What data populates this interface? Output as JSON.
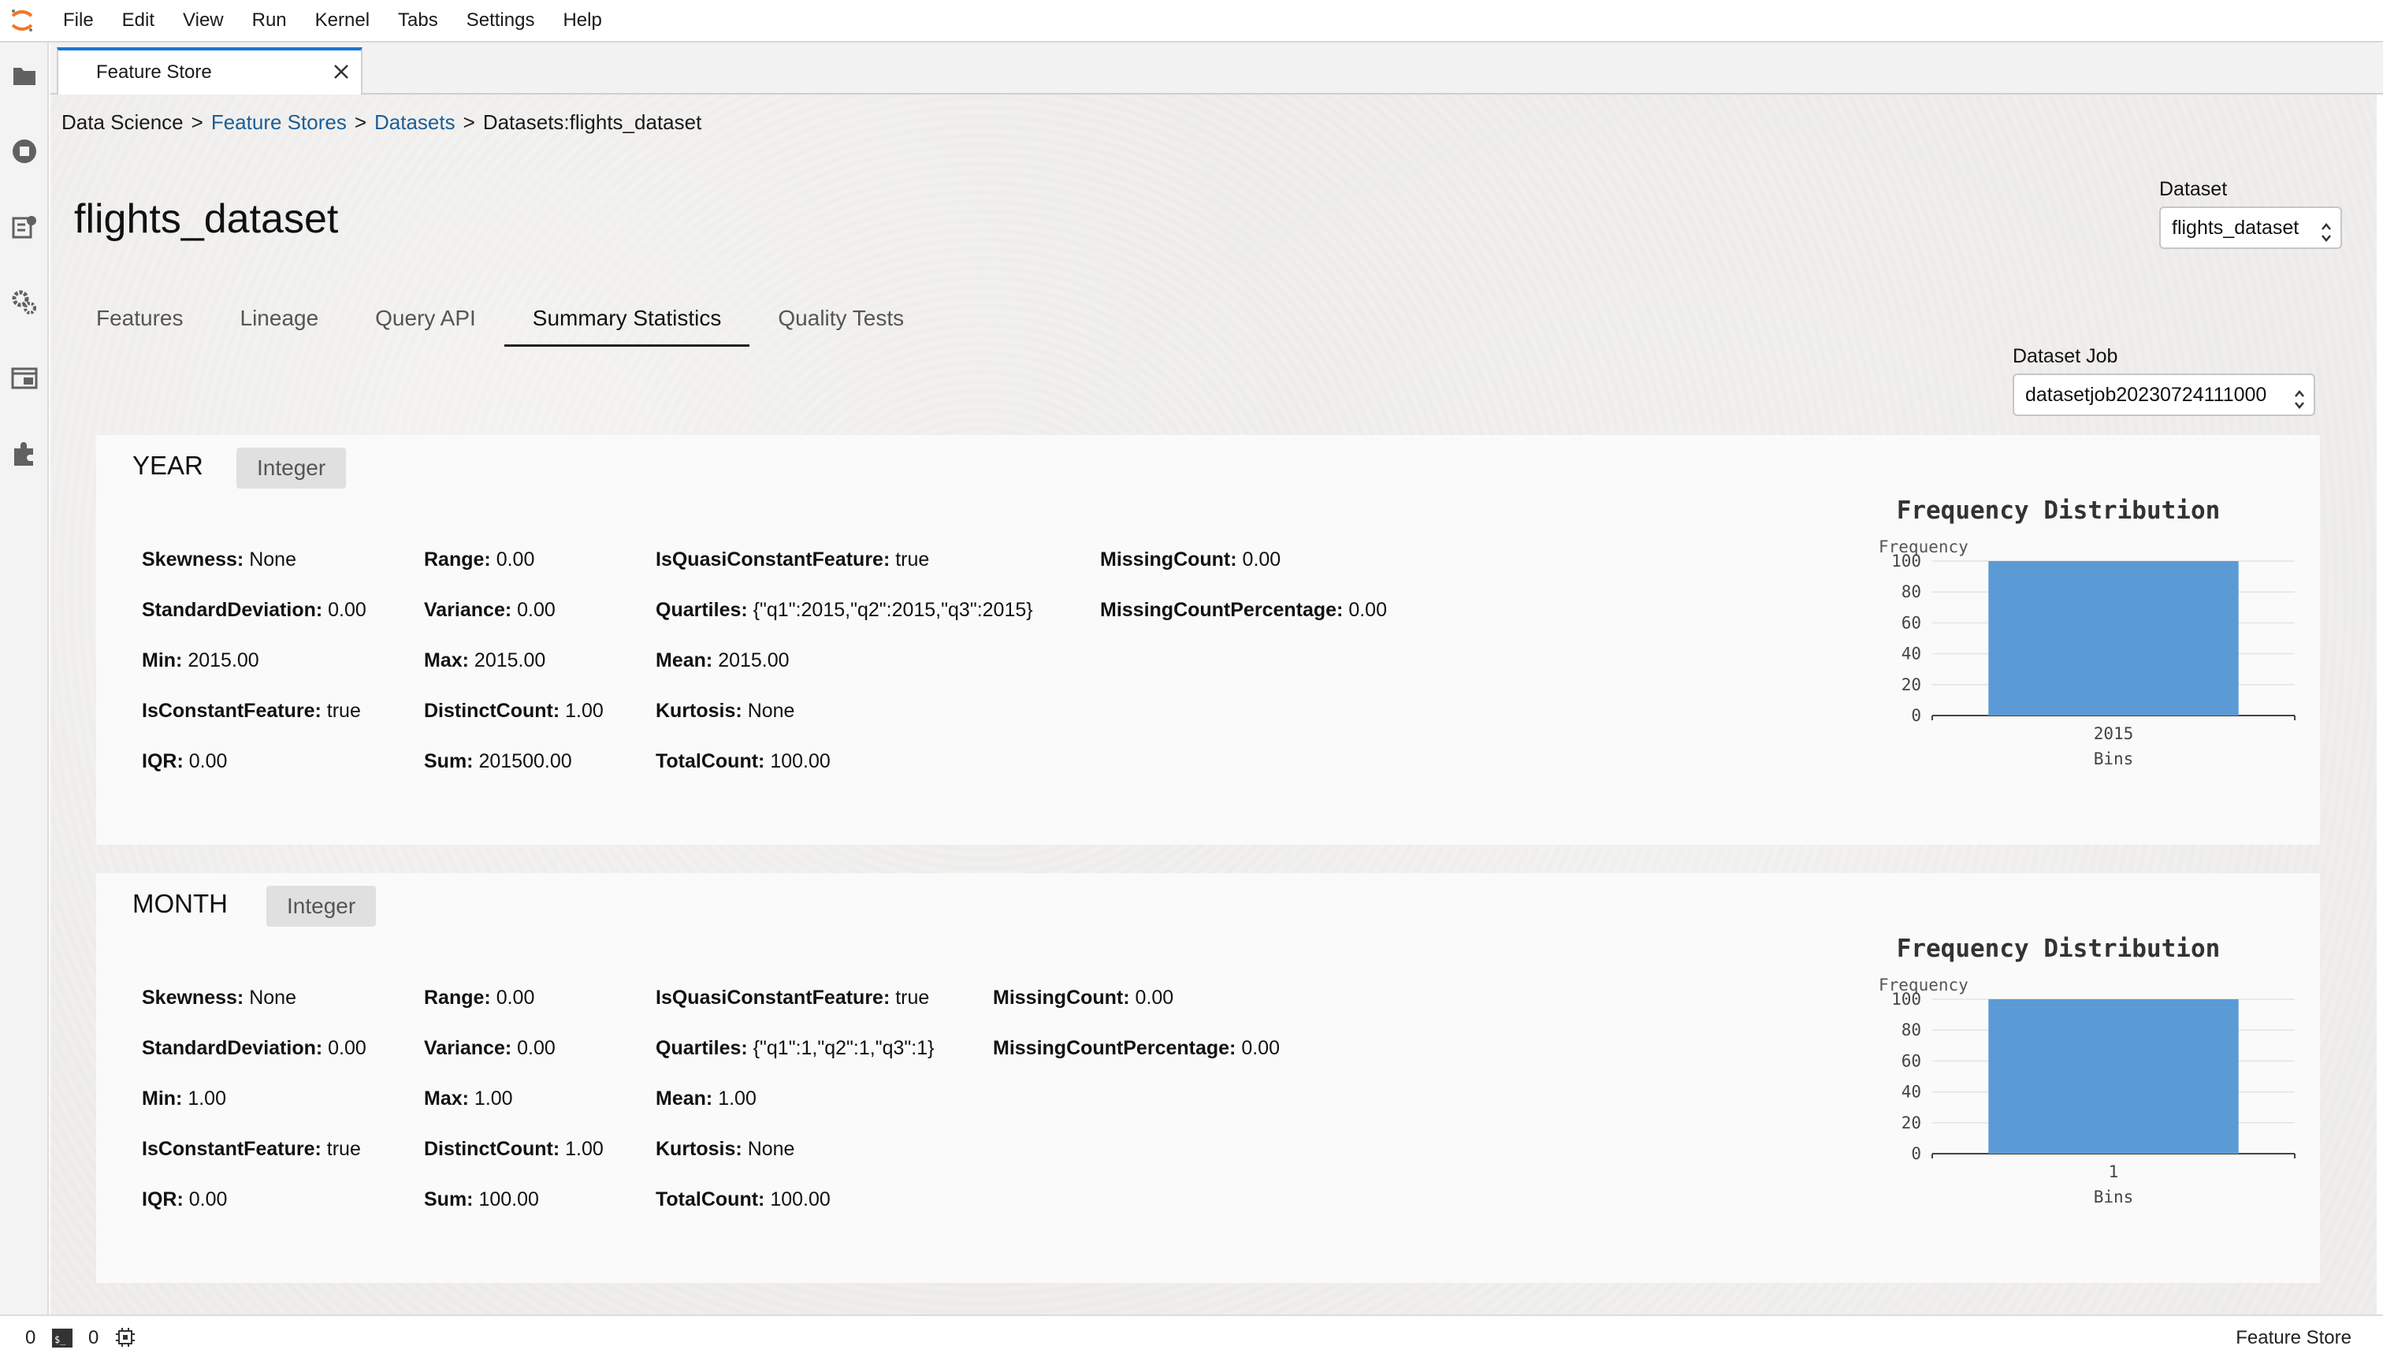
{
  "menu": [
    "File",
    "Edit",
    "View",
    "Run",
    "Kernel",
    "Tabs",
    "Settings",
    "Help"
  ],
  "sidebar_icons": [
    "folder-icon",
    "running-icon",
    "git-icon",
    "settings-icon",
    "window-icon",
    "extension-icon"
  ],
  "doc_tab": {
    "label": "Feature Store"
  },
  "breadcrumb": {
    "root": "Data Science",
    "sep": ">",
    "feature_stores": "Feature Stores",
    "datasets": "Datasets",
    "current": "Datasets:flights_dataset"
  },
  "page_title": "flights_dataset",
  "dataset_select": {
    "label": "Dataset",
    "value": "flights_dataset"
  },
  "job_select": {
    "label": "Dataset Job",
    "value": "datasetjob20230724111000"
  },
  "tabs": [
    "Features",
    "Lineage",
    "Query API",
    "Summary Statistics",
    "Quality Tests"
  ],
  "active_tab": "Summary Statistics",
  "features": [
    {
      "name": "YEAR",
      "type": "Integer",
      "stats": [
        [
          "Skewness:",
          "None"
        ],
        [
          "StandardDeviation:",
          "0.00"
        ],
        [
          "Min:",
          "2015.00"
        ],
        [
          "IsConstantFeature:",
          "true"
        ],
        [
          "IQR:",
          "0.00"
        ],
        [
          "Range:",
          "0.00"
        ],
        [
          "Variance:",
          "0.00"
        ],
        [
          "Max:",
          "2015.00"
        ],
        [
          "DistinctCount:",
          "1.00"
        ],
        [
          "Sum:",
          "201500.00"
        ],
        [
          "IsQuasiConstantFeature:",
          "true"
        ],
        [
          "Quartiles:",
          "{\"q1\":2015,\"q2\":2015,\"q3\":2015}"
        ],
        [
          "Mean:",
          "2015.00"
        ],
        [
          "Kurtosis:",
          "None"
        ],
        [
          "TotalCount:",
          "100.00"
        ],
        [
          "MissingCount:",
          "0.00"
        ],
        [
          "MissingCountPercentage:",
          "0.00"
        ]
      ]
    },
    {
      "name": "MONTH",
      "type": "Integer",
      "stats": [
        [
          "Skewness:",
          "None"
        ],
        [
          "StandardDeviation:",
          "0.00"
        ],
        [
          "Min:",
          "1.00"
        ],
        [
          "IsConstantFeature:",
          "true"
        ],
        [
          "IQR:",
          "0.00"
        ],
        [
          "Range:",
          "0.00"
        ],
        [
          "Variance:",
          "0.00"
        ],
        [
          "Max:",
          "1.00"
        ],
        [
          "DistinctCount:",
          "1.00"
        ],
        [
          "Sum:",
          "100.00"
        ],
        [
          "IsQuasiConstantFeature:",
          "true"
        ],
        [
          "Quartiles:",
          "{\"q1\":1,\"q2\":1,\"q3\":1}"
        ],
        [
          "Mean:",
          "1.00"
        ],
        [
          "Kurtosis:",
          "None"
        ],
        [
          "TotalCount:",
          "100.00"
        ],
        [
          "MissingCount:",
          "0.00"
        ],
        [
          "MissingCountPercentage:",
          "0.00"
        ]
      ]
    }
  ],
  "chart_data": [
    {
      "type": "bar",
      "title": "Frequency Distribution",
      "xlabel": "Bins",
      "ylabel": "Frequency",
      "categories": [
        "2015"
      ],
      "values": [
        100
      ],
      "ylim": [
        0,
        100
      ],
      "yticks": [
        0,
        20,
        40,
        60,
        80,
        100
      ],
      "grid": true,
      "color": "#5b9bd5"
    },
    {
      "type": "bar",
      "title": "Frequency Distribution",
      "xlabel": "Bins",
      "ylabel": "Frequency",
      "categories": [
        "1"
      ],
      "values": [
        100
      ],
      "ylim": [
        0,
        100
      ],
      "yticks": [
        0,
        20,
        40,
        60,
        80,
        100
      ],
      "grid": true,
      "color": "#5b9bd5"
    }
  ],
  "status": {
    "kernels": "0",
    "terminals": "0",
    "right": "Feature Store"
  }
}
